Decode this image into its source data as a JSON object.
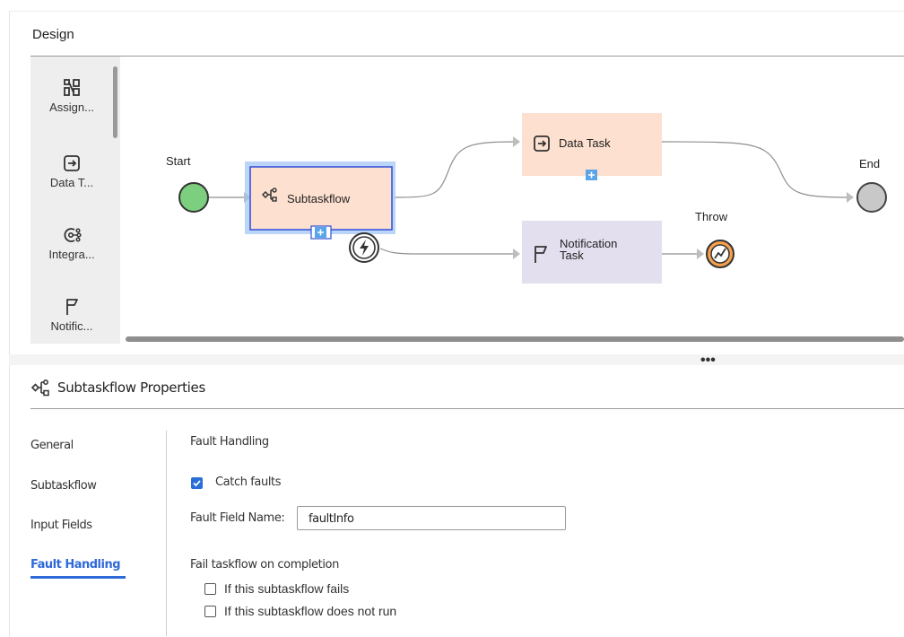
{
  "design": {
    "title": "Design",
    "palette": [
      {
        "label": "Assign...",
        "icon": "assignment-icon"
      },
      {
        "label": "Data T...",
        "icon": "data-task-icon"
      },
      {
        "label": "Integra...",
        "icon": "integration-icon"
      },
      {
        "label": "Notific...",
        "icon": "notification-flag-icon"
      }
    ],
    "canvas": {
      "start_label": "Start",
      "end_label": "End",
      "throw_label": "Throw",
      "subtaskflow_label": "Subtaskflow",
      "data_task_label": "Data Task",
      "notification_label_line1": "Notification",
      "notification_label_line2": "Task"
    }
  },
  "properties": {
    "title": "Subtaskflow Properties",
    "nav": [
      {
        "label": "General",
        "active": false
      },
      {
        "label": "Subtaskflow",
        "active": false
      },
      {
        "label": "Input Fields",
        "active": false
      },
      {
        "label": "Fault Handling",
        "active": true
      }
    ],
    "fault_handling": {
      "heading": "Fault Handling",
      "catch_faults_label": "Catch faults",
      "catch_faults_checked": true,
      "fault_field_label": "Fault Field Name:",
      "fault_field_value": "faultInfo",
      "fail_heading": "Fail taskflow on completion",
      "fail_option1": "If this subtaskflow fails",
      "fail_option1_checked": false,
      "fail_option2": "If this subtaskflow does not run",
      "fail_option2_checked": false
    }
  },
  "colors": {
    "accent": "#2f6ad9",
    "start_green": "#7ccf7f",
    "end_gray": "#c8c8c8",
    "task_orange": "#fde0cf",
    "task_purple": "#e3dfee",
    "throw_orange": "#f6a04e"
  }
}
